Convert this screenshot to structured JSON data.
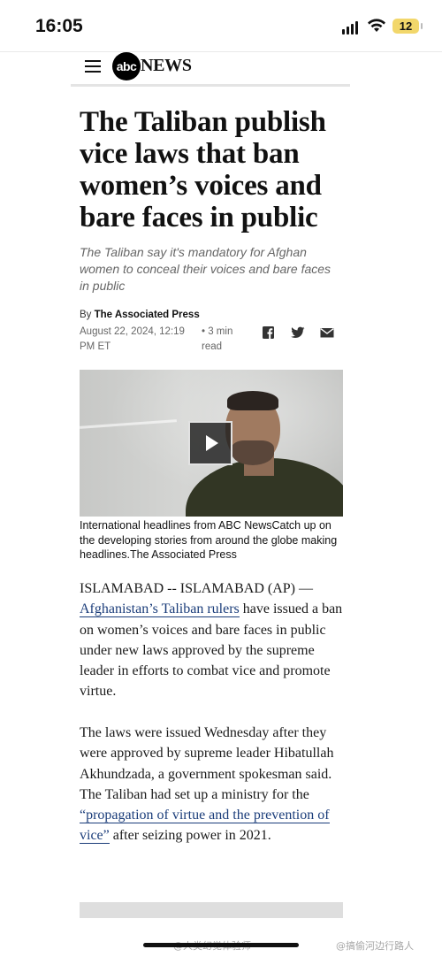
{
  "status_bar": {
    "time": "16:05",
    "battery": "12"
  },
  "header": {
    "logo_abc": "abc",
    "logo_news": "NEWS"
  },
  "article": {
    "headline": "The Taliban publish vice laws that ban women’s voices and bare faces in public",
    "dek": "The Taliban say it's mandatory for Afghan women to conceal their voices and bare faces in public",
    "byline_prefix": "By",
    "byline_author": "The Associated Press",
    "date": "August 22, 2024, 12:19 PM ET",
    "read_time": "• 3 min read",
    "share_icons": [
      "facebook-icon",
      "twitter-icon",
      "email-icon"
    ],
    "video_caption": "International headlines from ABC NewsCatch up on the developing stories from around the globe making headlines.The Associated Press",
    "paragraph1": {
      "lead": "ISLAMABAD -- ISLAMABAD (AP) —",
      "link": "Afghanistan’s Taliban rulers",
      "rest": "have issued a ban on women’s voices and bare faces in public under new laws approved by the supreme leader in efforts to combat vice and promote virtue."
    },
    "paragraph2": {
      "text_before": "The laws were issued Wednesday after they were approved by supreme leader Hibatullah Akhundzada, a government spokesman said. The Taliban had set up a ministry for the",
      "link": "“propagation of virtue and the prevention of vice”",
      "text_after": "after seizing power in 2021."
    }
  },
  "watermarks": {
    "left": "@人类幻觉体验师",
    "right": "@搞偷河边行路人"
  },
  "colors": {
    "link": "#1b3d7a",
    "battery": "#f2d76b",
    "dek": "#666666"
  }
}
